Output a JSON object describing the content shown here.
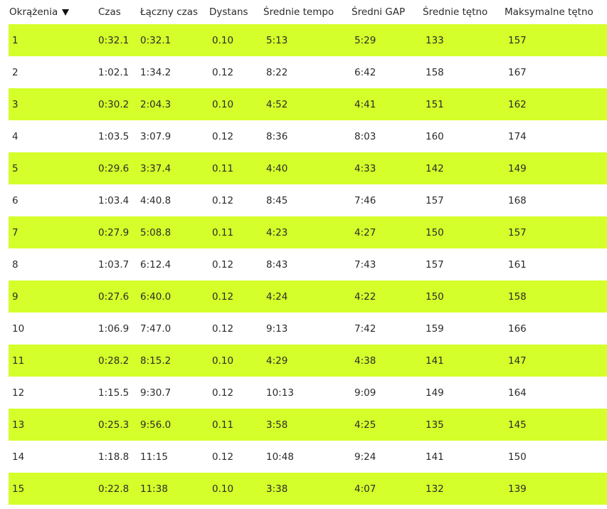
{
  "colors": {
    "row_highlight": "#d4ff2a",
    "text": "#2b2b2b"
  },
  "header": {
    "columns": [
      "Okrążenia",
      "Czas",
      "Łączny czas",
      "Dystans",
      "Średnie tempo",
      "Średni GAP",
      "Średnie tętno",
      "Maksymalne tętno"
    ],
    "sort_icon": "sort-descending-triangle-icon"
  },
  "rows": [
    [
      "1",
      "0:32.1",
      "0:32.1",
      "0.10",
      "5:13",
      "5:29",
      "133",
      "157"
    ],
    [
      "2",
      "1:02.1",
      "1:34.2",
      "0.12",
      "8:22",
      "6:42",
      "158",
      "167"
    ],
    [
      "3",
      "0:30.2",
      "2:04.3",
      "0.10",
      "4:52",
      "4:41",
      "151",
      "162"
    ],
    [
      "4",
      "1:03.5",
      "3:07.9",
      "0.12",
      "8:36",
      "8:03",
      "160",
      "174"
    ],
    [
      "5",
      "0:29.6",
      "3:37.4",
      "0.11",
      "4:40",
      "4:33",
      "142",
      "149"
    ],
    [
      "6",
      "1:03.4",
      "4:40.8",
      "0.12",
      "8:45",
      "7:46",
      "157",
      "168"
    ],
    [
      "7",
      "0:27.9",
      "5:08.8",
      "0.11",
      "4:23",
      "4:27",
      "150",
      "157"
    ],
    [
      "8",
      "1:03.7",
      "6:12.4",
      "0.12",
      "8:43",
      "7:43",
      "157",
      "161"
    ],
    [
      "9",
      "0:27.6",
      "6:40.0",
      "0.12",
      "4:24",
      "4:22",
      "150",
      "158"
    ],
    [
      "10",
      "1:06.9",
      "7:47.0",
      "0.12",
      "9:13",
      "7:42",
      "159",
      "166"
    ],
    [
      "11",
      "0:28.2",
      "8:15.2",
      "0.10",
      "4:29",
      "4:38",
      "141",
      "147"
    ],
    [
      "12",
      "1:15.5",
      "9:30.7",
      "0.12",
      "10:13",
      "9:09",
      "149",
      "164"
    ],
    [
      "13",
      "0:25.3",
      "9:56.0",
      "0.11",
      "3:58",
      "4:25",
      "135",
      "145"
    ],
    [
      "14",
      "1:18.8",
      "11:15",
      "0.12",
      "10:48",
      "9:24",
      "141",
      "150"
    ],
    [
      "15",
      "0:22.8",
      "11:38",
      "0.10",
      "3:38",
      "4:07",
      "132",
      "139"
    ]
  ]
}
